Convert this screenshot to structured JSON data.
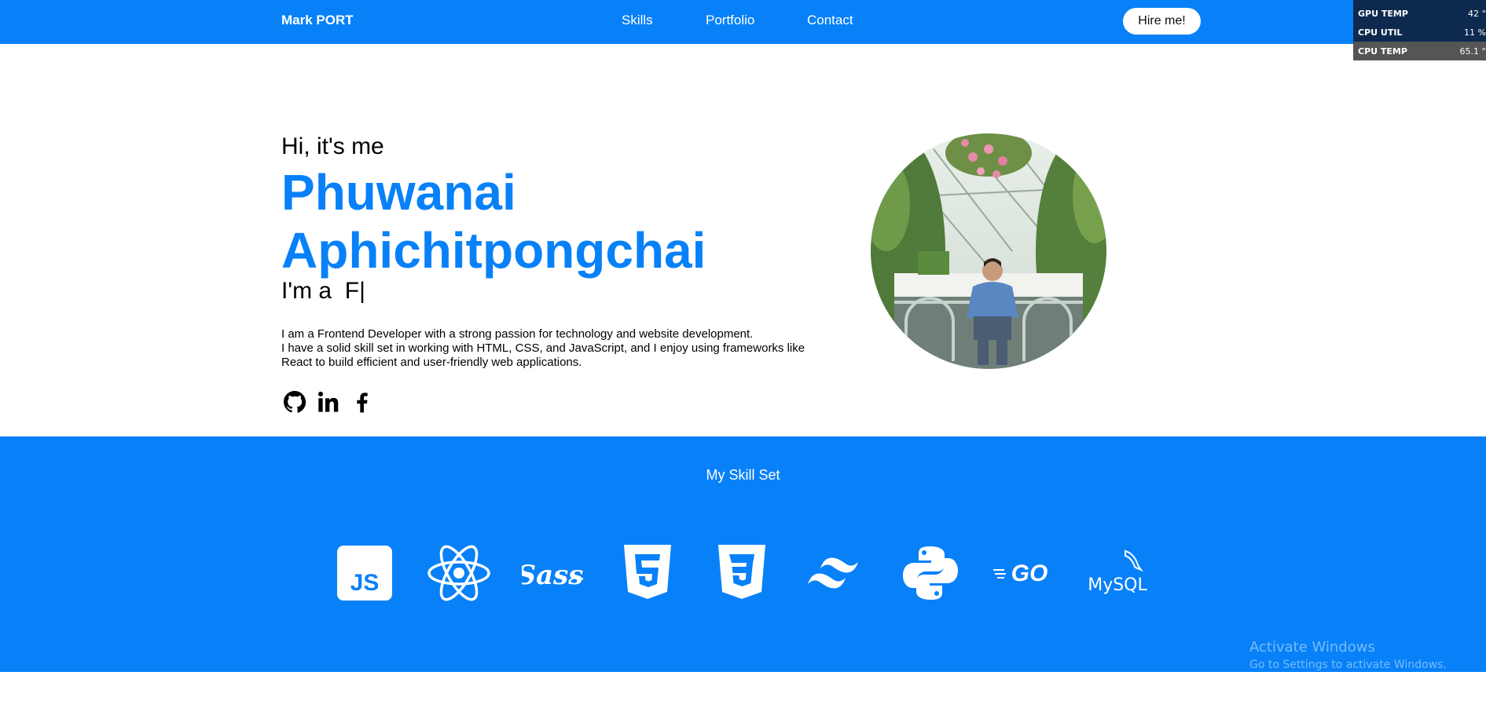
{
  "nav": {
    "brand": "Mark PORT",
    "links": [
      "Skills",
      "Portfolio",
      "Contact"
    ],
    "hire_label": "Hire me!"
  },
  "hw_monitor": {
    "rows": [
      {
        "label": "GPU TEMP",
        "value": "42 °"
      },
      {
        "label": "CPU UTIL",
        "value": "11 %"
      },
      {
        "label": "CPU TEMP",
        "value": "65.1 °"
      }
    ]
  },
  "hero": {
    "greeting": "Hi, it's me",
    "first_name": "Phuwanai",
    "last_name": "Aphichitpongchai",
    "role_prefix": "I'm a",
    "role_typed": "F|",
    "bio_lines": [
      "I am a Frontend Developer with a strong passion for technology and website development.",
      "I have a solid skill set in working with HTML, CSS, and JavaScript, and I enjoy using frameworks like",
      "React to build efficient and user-friendly web applications."
    ],
    "socials": [
      "github-icon",
      "linkedin-icon",
      "facebook-icon"
    ]
  },
  "skills": {
    "title": "My Skill Set",
    "items": [
      "javascript-icon",
      "react-icon",
      "sass-icon",
      "html5-icon",
      "css3-icon",
      "tailwind-icon",
      "python-icon",
      "go-icon",
      "mysql-icon"
    ],
    "js_label": "JS",
    "sass_label": "Sass",
    "go_label": "GO",
    "mysql_label": "MySQL"
  },
  "windows_watermark": {
    "title": "Activate Windows",
    "subtitle": "Go to Settings to activate Windows."
  },
  "colors": {
    "brand_blue": "#0881F8",
    "white": "#ffffff"
  }
}
